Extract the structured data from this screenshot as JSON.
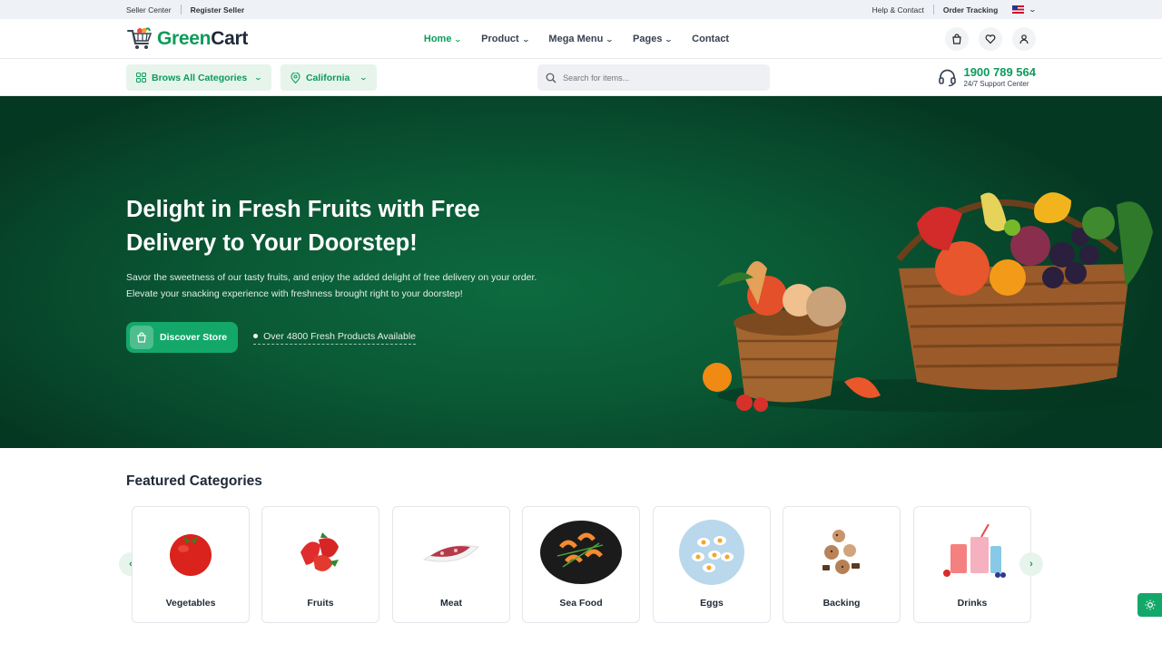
{
  "topbar": {
    "seller_center": "Seller Center",
    "register_seller": "Register Seller",
    "help_contact": "Help & Contact",
    "order_tracking": "Order Tracking"
  },
  "header": {
    "logo_green": "Green",
    "logo_dark": "Cart",
    "nav": [
      {
        "label": "Home",
        "active": true
      },
      {
        "label": "Product"
      },
      {
        "label": "Mega Menu"
      },
      {
        "label": "Pages"
      },
      {
        "label": "Contact"
      }
    ]
  },
  "search_row": {
    "categories_label": "Brows All Categories",
    "location_label": "California",
    "search_placeholder": "Search for items...",
    "phone": "1900 789 564",
    "support_text": "24/7 Support Center"
  },
  "hero": {
    "title_line1": "Delight in Fresh Fruits with Free",
    "title_line2": "Delivery to Your Doorstep!",
    "description": "Savor the sweetness of our tasty fruits, and enjoy the added delight of free delivery on your order. Elevate your snacking experience with freshness brought right to your doorstep!",
    "cta_label": "Discover Store",
    "availability": "Over 4800 Fresh Products Available"
  },
  "featured": {
    "title": "Featured Categories",
    "categories": [
      {
        "name": "Vegetables",
        "icon": "tomato-icon"
      },
      {
        "name": "Fruits",
        "icon": "strawberry-icon"
      },
      {
        "name": "Meat",
        "icon": "meat-icon"
      },
      {
        "name": "Sea Food",
        "icon": "shrimp-icon"
      },
      {
        "name": "Eggs",
        "icon": "eggs-icon"
      },
      {
        "name": "Backing",
        "icon": "cookies-icon"
      },
      {
        "name": "Drinks",
        "icon": "drinks-icon"
      }
    ]
  },
  "colors": {
    "brand": "#0c9b5b",
    "hero_bg": "#0a5a35",
    "button": "#13a86a"
  }
}
